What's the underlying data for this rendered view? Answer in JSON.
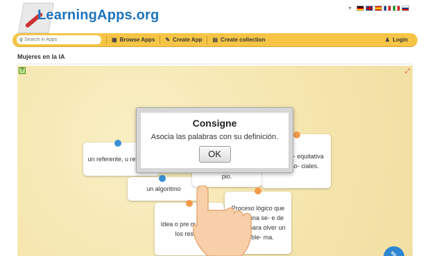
{
  "header": {
    "logo_text": "LearningApps.org",
    "languages": [
      "de",
      "en",
      "es",
      "fr",
      "it",
      "ru"
    ]
  },
  "nav": {
    "search_placeholder": "Search in Apps",
    "browse": "Browse Apps",
    "create_app": "Create App",
    "create_collection": "Create collection",
    "login": "Login"
  },
  "page": {
    "title": "Mujeres en la IA"
  },
  "cards": {
    "c1": "un referente, u referente",
    "c2": "represen- equitativa rupos so- ciales.",
    "c3": "un algoritmo",
    "c4": "pio.",
    "c5": "Idea o pre que distor los res u s",
    "c6": "Proceso lógico que sigue una se- e de pasos para olver un proble- ma."
  },
  "dialog": {
    "title": "Consigne",
    "message": "Asocia las palabras con su definición.",
    "ok": "OK"
  },
  "colors": {
    "brand": "#1e73be",
    "nav_bar": "#f6c546",
    "app_bg": "#f7ebb7",
    "dot_blue": "#3a8fd6",
    "dot_orange": "#f29a4a"
  }
}
